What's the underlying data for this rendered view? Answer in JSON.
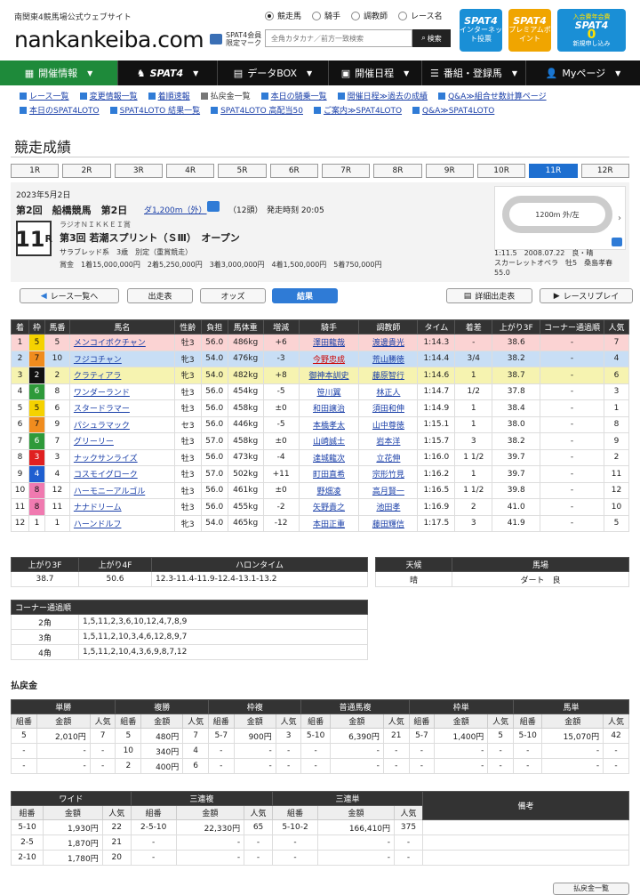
{
  "header": {
    "tagline": "南関東4競馬場公式ウェブサイト",
    "logo": "nankankeiba.com",
    "member_mark": [
      "SPAT4会員",
      "限定マーク"
    ],
    "radios": [
      "競走馬",
      "騎手",
      "調教師",
      "レース名"
    ],
    "search_placeholder": "全角カタカナ／前方一致検索",
    "search_label": "検索",
    "promos": [
      {
        "title": "SPAT4",
        "sub": "インターネット投票",
        "color": "#1a8fd6"
      },
      {
        "title": "SPAT4",
        "sub": "プレミアムポイント",
        "color": "#f0a500"
      },
      {
        "title": "SPAT4",
        "sub": "新規申し込み",
        "color": "#1a8fd6",
        "badge": "0",
        "badge_note": "入会費年会費"
      }
    ]
  },
  "nav": [
    {
      "label": "開催情報",
      "active": true
    },
    {
      "label": "SPAT4"
    },
    {
      "label": "データBOX"
    },
    {
      "label": "開催日程"
    },
    {
      "label": "番組・登録馬"
    },
    {
      "label": "Myページ"
    }
  ],
  "sublinks": [
    [
      {
        "t": "レース一覧"
      },
      {
        "t": "変更情報一覧"
      },
      {
        "t": "着順速報"
      },
      {
        "t": "払戻金一覧",
        "plain": true
      },
      {
        "t": "本日の騎乗一覧"
      },
      {
        "t": "開催日程≫過去の成績"
      },
      {
        "t": "Q&A≫組合せ数計算ページ"
      }
    ],
    [
      {
        "t": "本日のSPAT4LOTO"
      },
      {
        "t": "SPAT4LOTO 結果一覧"
      },
      {
        "t": "SPAT4LOTO 高配当50"
      },
      {
        "t": "ご案内≫SPAT4LOTO"
      },
      {
        "t": "Q&A≫SPAT4LOTO"
      }
    ]
  ],
  "page_title": "競走成績",
  "race_tabs": [
    "1R",
    "2R",
    "3R",
    "4R",
    "5R",
    "6R",
    "7R",
    "8R",
    "9R",
    "10R",
    "11R",
    "12R"
  ],
  "active_tab": "11R",
  "race": {
    "date": "2023年5月2日",
    "meeting": "第2回　船橋競馬　第2日",
    "distance": "ダ1,200m（外）",
    "heads": "（12頭）　発走時刻 20:05",
    "number": "11",
    "number_suffix": "R",
    "sponsor": "ラジオＮＩＫＫＥＩ賞",
    "name": "第3回 若潮スプリント（ＳⅢ）　オープン",
    "conditions": "サラブレッド系　3歳　別定（重賞競走）",
    "prize": "賞金　1着15,000,000円　2着5,250,000円　3着3,000,000円　4着1,500,000円　5着750,000円",
    "course_label": "1200m 外/左",
    "record": "1:11.5　2008.07.22　良・晴",
    "record_horse": "スカーレットオペラ　牡5　桑島孝春",
    "record_weight": "55.0"
  },
  "buttons": {
    "back": "レース一覧へ",
    "entries": "出走表",
    "odds": "オッズ",
    "result": "結果",
    "detail": "詳細出走表",
    "replay": "レースリプレイ"
  },
  "result_headers": [
    "着",
    "枠",
    "馬番",
    "馬名",
    "性齢",
    "負担",
    "馬体重",
    "増減",
    "騎手",
    "調教師",
    "タイム",
    "着差",
    "上がり3F",
    "コーナー通過順",
    "人気"
  ],
  "results": [
    [
      "1",
      "5",
      "5",
      "メンコイボクチャン",
      "牡3",
      "56.0",
      "486kg",
      "+6",
      "澤田龍哉",
      "渡邊貴光",
      "1:14.3",
      "-",
      "38.6",
      "-",
      "7"
    ],
    [
      "2",
      "7",
      "10",
      "フジコチャン",
      "牝3",
      "54.0",
      "476kg",
      "-3",
      "今野忠成",
      "荒山勝徳",
      "1:14.4",
      "3/4",
      "38.2",
      "-",
      "4"
    ],
    [
      "3",
      "2",
      "2",
      "クラティアラ",
      "牝3",
      "54.0",
      "482kg",
      "+8",
      "御神本訓史",
      "藤原智行",
      "1:14.6",
      "1",
      "38.7",
      "-",
      "6"
    ],
    [
      "4",
      "6",
      "8",
      "ワンダーランド",
      "牡3",
      "56.0",
      "454kg",
      "-5",
      "笹川翼",
      "林正人",
      "1:14.7",
      "1/2",
      "37.8",
      "-",
      "3"
    ],
    [
      "5",
      "5",
      "6",
      "スタードラマー",
      "牡3",
      "56.0",
      "458kg",
      "±0",
      "和田譲治",
      "須田和伸",
      "1:14.9",
      "1",
      "38.4",
      "-",
      "1"
    ],
    [
      "6",
      "7",
      "9",
      "パシュラマック",
      "セ3",
      "56.0",
      "446kg",
      "-5",
      "本橋孝太",
      "山中尊徳",
      "1:15.1",
      "1",
      "38.0",
      "-",
      "8"
    ],
    [
      "7",
      "6",
      "7",
      "グリーリー",
      "牡3",
      "57.0",
      "458kg",
      "±0",
      "山崎誠士",
      "岩本洋",
      "1:15.7",
      "3",
      "38.2",
      "-",
      "9"
    ],
    [
      "8",
      "3",
      "3",
      "ナックサンライズ",
      "牡3",
      "56.0",
      "473kg",
      "-4",
      "達城龍次",
      "立花伸",
      "1:16.0",
      "1 1/2",
      "39.7",
      "-",
      "2"
    ],
    [
      "9",
      "4",
      "4",
      "コスモイグローク",
      "牡3",
      "57.0",
      "502kg",
      "+11",
      "町田直希",
      "宗形竹見",
      "1:16.2",
      "1",
      "39.7",
      "-",
      "11"
    ],
    [
      "10",
      "8",
      "12",
      "ハーモニーアルゴル",
      "牡3",
      "56.0",
      "461kg",
      "±0",
      "野畑凌",
      "高月賢一",
      "1:16.5",
      "1 1/2",
      "39.8",
      "-",
      "12"
    ],
    [
      "11",
      "8",
      "11",
      "ナナドリーム",
      "牡3",
      "56.0",
      "455kg",
      "-2",
      "矢野貴之",
      "池田孝",
      "1:16.9",
      "2",
      "41.0",
      "-",
      "10"
    ],
    [
      "12",
      "1",
      "1",
      "ハーンドルフ",
      "牝3",
      "54.0",
      "465kg",
      "-12",
      "本田正重",
      "藤田輝信",
      "1:17.5",
      "3",
      "41.9",
      "-",
      "5"
    ]
  ],
  "frame_colors": {
    "1": "#ffffff",
    "2": "#111111",
    "3": "#e02020",
    "4": "#1f5fd0",
    "5": "#f5d200",
    "6": "#2e9a3a",
    "7": "#f08c1e",
    "8": "#f07ab0"
  },
  "row_colors": {
    "1": "#fbd3d3",
    "2": "#c8def5",
    "3": "#f6f3b0"
  },
  "lap": {
    "headers": [
      "上がり3F",
      "上がり4F",
      "ハロンタイム"
    ],
    "values": [
      "38.7",
      "50.6",
      "12.3-11.4-11.9-12.4-13.1-13.2"
    ]
  },
  "weather": {
    "headers": [
      "天候",
      "馬場"
    ],
    "values": [
      "晴",
      "ダート　良"
    ]
  },
  "corners": {
    "title": "コーナー通過順",
    "rows": [
      [
        "2角",
        "1,5,11,2,3,6,10,12,4,7,8,9"
      ],
      [
        "3角",
        "1,5,11,2,10,3,4,6,12,8,9,7"
      ],
      [
        "4角",
        "1,5,11,2,10,4,3,6,9,8,7,12"
      ]
    ]
  },
  "payout_title": "払戻金",
  "payout1": {
    "groups": [
      "単勝",
      "複勝",
      "枠複",
      "普通馬複",
      "枠単",
      "馬単"
    ],
    "sub": [
      "組番",
      "金額",
      "人気"
    ],
    "rows": [
      [
        "5",
        "2,010円",
        "7",
        "5",
        "480円",
        "7",
        "5-7",
        "900円",
        "3",
        "5-10",
        "6,390円",
        "21",
        "5-7",
        "1,400円",
        "5",
        "5-10",
        "15,070円",
        "42"
      ],
      [
        "-",
        "-",
        "-",
        "10",
        "340円",
        "4",
        "-",
        "-",
        "-",
        "-",
        "-",
        "-",
        "-",
        "-",
        "-",
        "-",
        "-",
        "-"
      ],
      [
        "-",
        "-",
        "-",
        "2",
        "400円",
        "6",
        "-",
        "-",
        "-",
        "-",
        "-",
        "-",
        "-",
        "-",
        "-",
        "-",
        "-",
        "-"
      ]
    ]
  },
  "payout2": {
    "groups": [
      "ワイド",
      "三連複",
      "三連単",
      "備考"
    ],
    "sub": [
      "組番",
      "金額",
      "人気"
    ],
    "rows": [
      [
        "5-10",
        "1,930円",
        "22",
        "2-5-10",
        "22,330円",
        "65",
        "5-10-2",
        "166,410円",
        "375",
        ""
      ],
      [
        "2-5",
        "1,870円",
        "21",
        "-",
        "-",
        "-",
        "-",
        "-",
        "-",
        ""
      ],
      [
        "2-10",
        "1,780円",
        "20",
        "-",
        "-",
        "-",
        "-",
        "-",
        "-",
        ""
      ]
    ]
  },
  "bottom_button": "払戻金一覧"
}
